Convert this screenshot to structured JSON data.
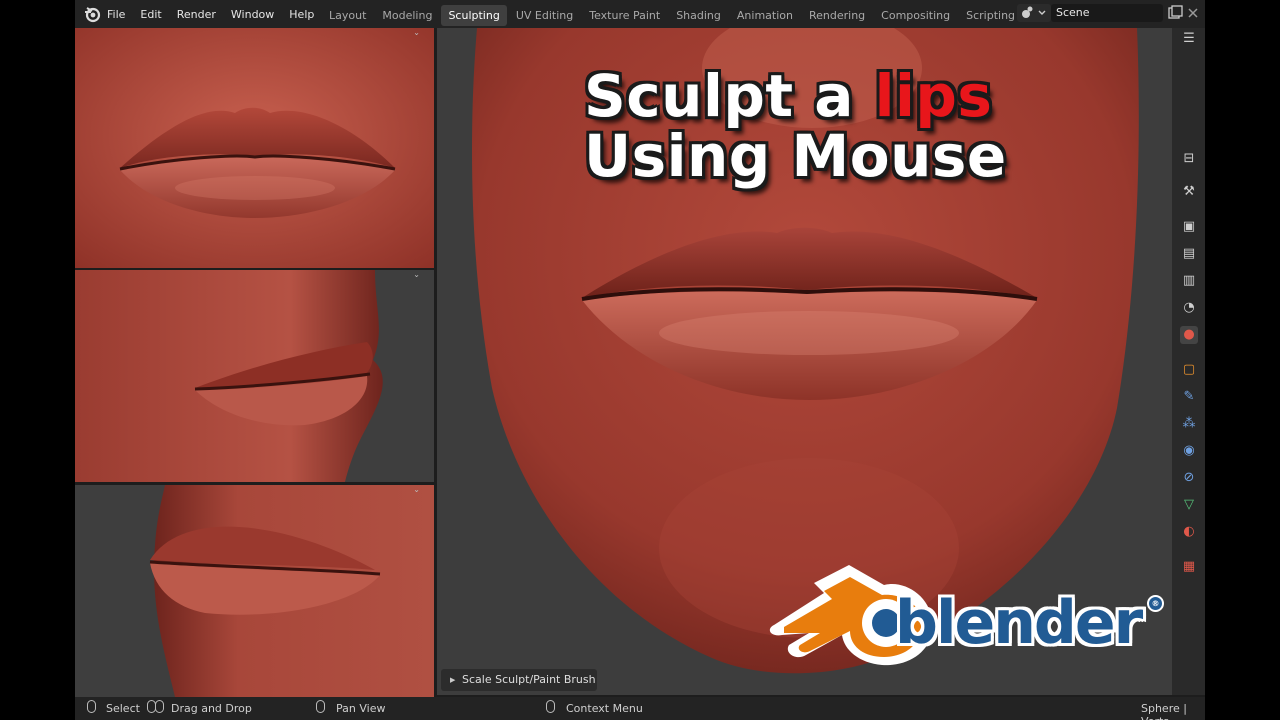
{
  "menu": [
    "File",
    "Edit",
    "Render",
    "Window",
    "Help"
  ],
  "tabs": [
    "Layout",
    "Modeling",
    "Sculpting",
    "UV Editing",
    "Texture Paint",
    "Shading",
    "Animation",
    "Rendering",
    "Compositing",
    "Scripting"
  ],
  "active_tab": "Sculpting",
  "add_tab_label": "+",
  "scene": "Scene",
  "overlay": {
    "line1_a": "Sculpt a ",
    "line1_b": "lips",
    "line2": "Using Mouse"
  },
  "operator_panel": "Scale Sculpt/Paint Brush",
  "brand": {
    "word": "blender",
    "reg": "®",
    "accent": "#e87d0d",
    "blue": "#215b94"
  },
  "status": {
    "select": "Select",
    "drag": "Drag and Drop",
    "pan": "Pan View",
    "context": "Context Menu",
    "info": "Sphere | Verts"
  },
  "icons": {
    "top": [
      "blender-logo-icon",
      "scene-type-icon",
      "new-scene-icon",
      "close-icon"
    ],
    "props": [
      "tool-icon",
      "render-icon",
      "output-icon",
      "view-layer-icon",
      "scene-icon",
      "world-icon",
      "object-icon",
      "modifier-icon",
      "particles-icon",
      "physics-icon",
      "constraints-icon",
      "data-icon",
      "material-icon",
      "texture-icon"
    ]
  },
  "colors": {
    "skin": "#9e3b30",
    "skin_light": "#c25a4b",
    "viewport_bg": "#3d3d3d"
  }
}
